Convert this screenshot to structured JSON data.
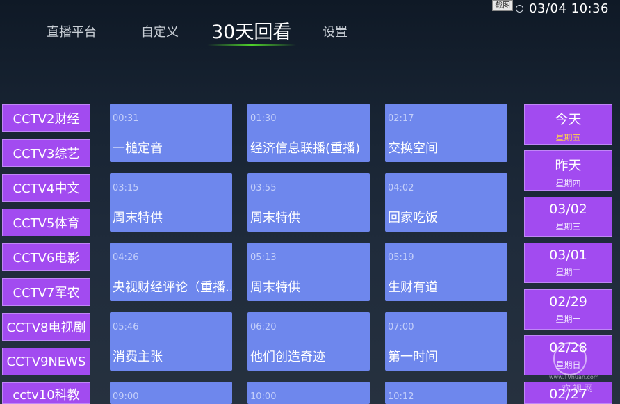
{
  "status": {
    "screenshot_badge": "截图",
    "datetime": "03/04  10:36"
  },
  "tabs": [
    {
      "label": "直播平台"
    },
    {
      "label": "自定义"
    },
    {
      "label": "30天回看"
    },
    {
      "label": "设置"
    }
  ],
  "channels": [
    {
      "label": "CCTV2财经"
    },
    {
      "label": "CCTV3综艺"
    },
    {
      "label": "CCTV4中文"
    },
    {
      "label": "CCTV5体育"
    },
    {
      "label": "CCTV6电影"
    },
    {
      "label": "CCTV7军农"
    },
    {
      "label": "CCTV8电视剧"
    },
    {
      "label": "CCTV9NEWS"
    },
    {
      "label": "cctv10科教"
    }
  ],
  "programs": [
    {
      "time": "00:31",
      "title": "一槌定音"
    },
    {
      "time": "01:30",
      "title": "经济信息联播(重播)"
    },
    {
      "time": "02:17",
      "title": "交换空间"
    },
    {
      "time": "03:15",
      "title": "周末特供"
    },
    {
      "time": "03:55",
      "title": "周末特供"
    },
    {
      "time": "04:02",
      "title": "回家吃饭"
    },
    {
      "time": "04:26",
      "title": "央视财经评论（重播.."
    },
    {
      "time": "05:13",
      "title": "周末特供"
    },
    {
      "time": "05:19",
      "title": "生财有道"
    },
    {
      "time": "05:46",
      "title": "消费主张"
    },
    {
      "time": "06:20",
      "title": "他们创造奇迹"
    },
    {
      "time": "07:00",
      "title": "第一时间"
    },
    {
      "time": "09:00",
      "title": ""
    },
    {
      "time": "10:00",
      "title": ""
    },
    {
      "time": "10:12",
      "title": ""
    }
  ],
  "dates": [
    {
      "label": "今天",
      "weekday": "星期五"
    },
    {
      "label": "昨天",
      "weekday": "星期四"
    },
    {
      "label": "03/02",
      "weekday": "星期三"
    },
    {
      "label": "03/01",
      "weekday": "星期二"
    },
    {
      "label": "02/29",
      "weekday": "星期一"
    },
    {
      "label": "02/28",
      "weekday": "星期日"
    },
    {
      "label": "02/27",
      "weekday": ""
    }
  ],
  "watermark": {
    "url": "www.TVhuan.com",
    "text": "欢视网"
  },
  "colors": {
    "tile": "#6e87ed",
    "accent_purple": "#a24bf0",
    "indicator": "#4fd22b",
    "today_weekday": "#ffd24a"
  }
}
